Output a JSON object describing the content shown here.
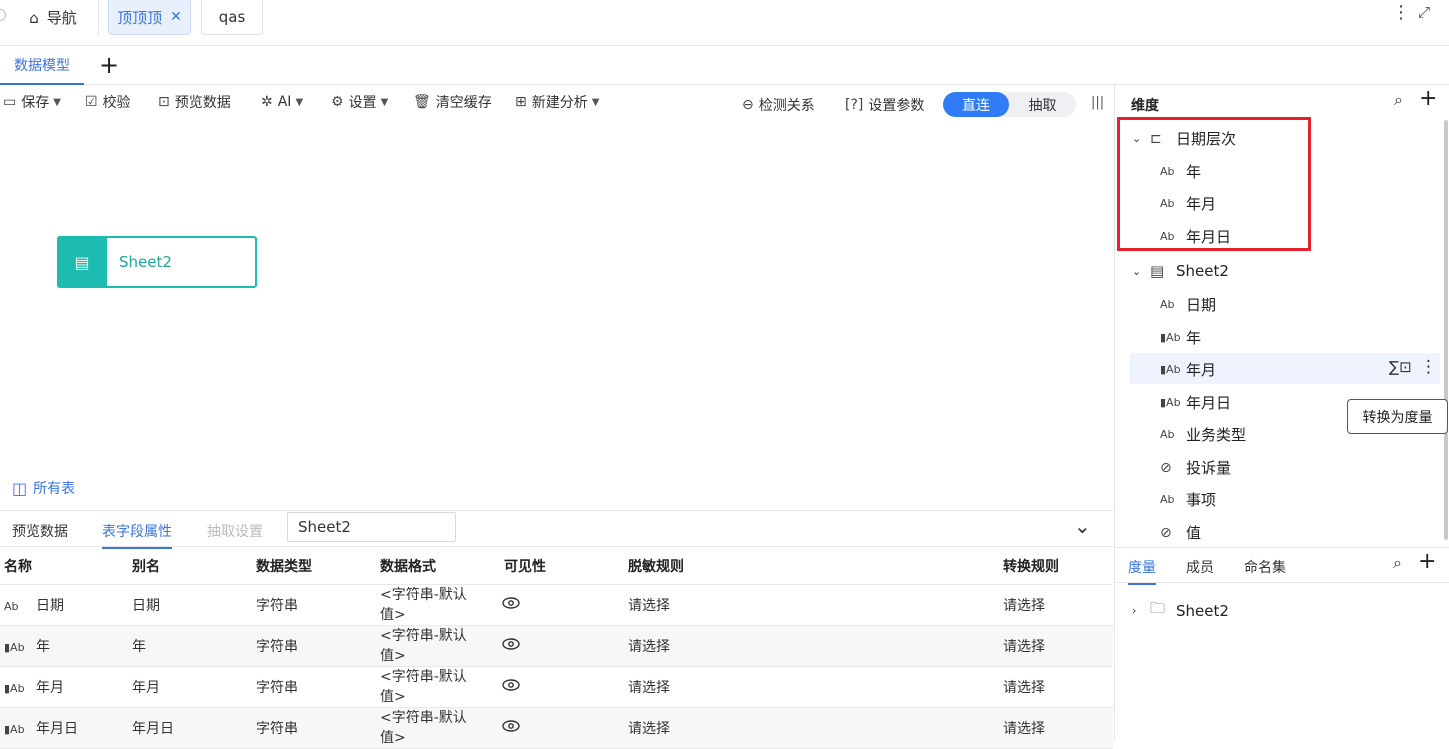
{
  "top_tabs": [
    {
      "label": "导航"
    },
    {
      "label": "顶顶顶"
    },
    {
      "label": "qas"
    }
  ],
  "model_tab": "数据模型",
  "toolbar": {
    "save": "保存",
    "validate": "校验",
    "preview": "预览数据",
    "ai": "AI",
    "settings": "设置",
    "clear_cache": "清空缓存",
    "new_analysis": "新建分析",
    "detect_relation": "检测关系",
    "set_params": "设置参数",
    "mode_direct": "直连",
    "mode_extract": "抽取"
  },
  "canvas": {
    "node_label": "Sheet2",
    "all_tables": "所有表"
  },
  "bottom": {
    "tabs": [
      "预览数据",
      "表字段属性",
      "抽取设置"
    ],
    "sheet_select": "Sheet2",
    "columns": [
      "名称",
      "别名",
      "数据类型",
      "数据格式",
      "可见性",
      "脱敏规则",
      "转换规则"
    ],
    "rows": [
      {
        "type": "Ab",
        "name": "日期",
        "alias": "日期",
        "dtype": "字符串",
        "fmt1": "<字符串-默认",
        "fmt2": "值>",
        "mask": "请选择",
        "conv": "请选择"
      },
      {
        "type": "▮Ab",
        "name": "年",
        "alias": "年",
        "dtype": "字符串",
        "fmt1": "<字符串-默认",
        "fmt2": "值>",
        "mask": "请选择",
        "conv": "请选择"
      },
      {
        "type": "▮Ab",
        "name": "年月",
        "alias": "年月",
        "dtype": "字符串",
        "fmt1": "<字符串-默认",
        "fmt2": "值>",
        "mask": "请选择",
        "conv": "请选择"
      },
      {
        "type": "▮Ab",
        "name": "年月日",
        "alias": "年月日",
        "dtype": "字符串",
        "fmt1": "<字符串-默认",
        "fmt2": "值>",
        "mask": "请选择",
        "conv": "请选择"
      }
    ]
  },
  "dimension": {
    "title": "维度",
    "hierarchy": {
      "label": "日期层次",
      "children": [
        "年",
        "年月",
        "年月日"
      ]
    },
    "sheet": {
      "label": "Sheet2",
      "fields": [
        {
          "type": "Ab",
          "label": "日期"
        },
        {
          "type": "▮Ab",
          "label": "年"
        },
        {
          "type": "▮Ab",
          "label": "年月"
        },
        {
          "type": "▮Ab",
          "label": "年月日"
        },
        {
          "type": "Ab",
          "label": "业务类型"
        },
        {
          "type": "hidden",
          "label": "投诉量"
        },
        {
          "type": "Ab",
          "label": "事项"
        },
        {
          "type": "hidden",
          "label": "值"
        }
      ]
    },
    "tooltip": "转换为度量"
  },
  "measure_tabs": [
    "度量",
    "成员",
    "命名集"
  ],
  "measure_tree": {
    "label": "Sheet2"
  },
  "colors": {
    "accent": "#2f7cf6",
    "node": "#1cbdb0",
    "highlight": "#e8202b"
  }
}
